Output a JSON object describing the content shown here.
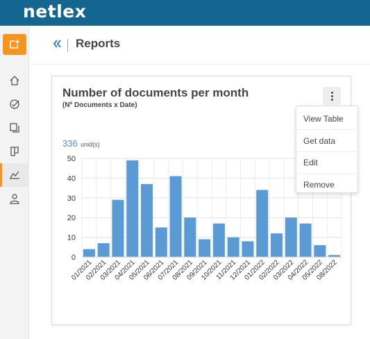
{
  "app": {
    "logo_text": "netlex"
  },
  "sidebar": {
    "items": [
      {
        "name": "add",
        "icon": "add-document-icon"
      },
      {
        "name": "home",
        "icon": "home-icon"
      },
      {
        "name": "tasks",
        "icon": "check-circle-icon"
      },
      {
        "name": "documents",
        "icon": "documents-icon"
      },
      {
        "name": "board",
        "icon": "board-icon"
      },
      {
        "name": "reports",
        "icon": "chart-icon",
        "active": true
      },
      {
        "name": "users",
        "icon": "user-icon"
      }
    ]
  },
  "header": {
    "title": "Reports",
    "back_icon": "double-chevron-left-icon"
  },
  "card": {
    "title": "Number of documents per month",
    "subtitle": "(Nº Documents x Date)",
    "metric": {
      "value": "336",
      "unit": "unid(s)"
    },
    "menu_icon": "kebab-icon",
    "menu": [
      "View Table",
      "Get data",
      "Edit",
      "Remove"
    ]
  },
  "colors": {
    "topbar": "#156591",
    "accent": "#f7941d",
    "bar": "#5b9bd5"
  },
  "chart_data": {
    "type": "bar",
    "categories": [
      "01/2021",
      "02/2021",
      "03/2021",
      "04/2021",
      "05/2021",
      "06/2021",
      "07/2021",
      "08/2021",
      "09/2021",
      "10/2021",
      "11/2021",
      "12/2021",
      "01/2022",
      "02/2022",
      "03/2022",
      "04/2022",
      "05/2022",
      "08/2022"
    ],
    "values": [
      4,
      7,
      29,
      49,
      37,
      15,
      41,
      20,
      9,
      17,
      10,
      8,
      34,
      12,
      20,
      17,
      6,
      1
    ],
    "ylim": [
      0,
      50
    ],
    "yticks": [
      0,
      10,
      20,
      30,
      40,
      50
    ],
    "grid": true
  }
}
